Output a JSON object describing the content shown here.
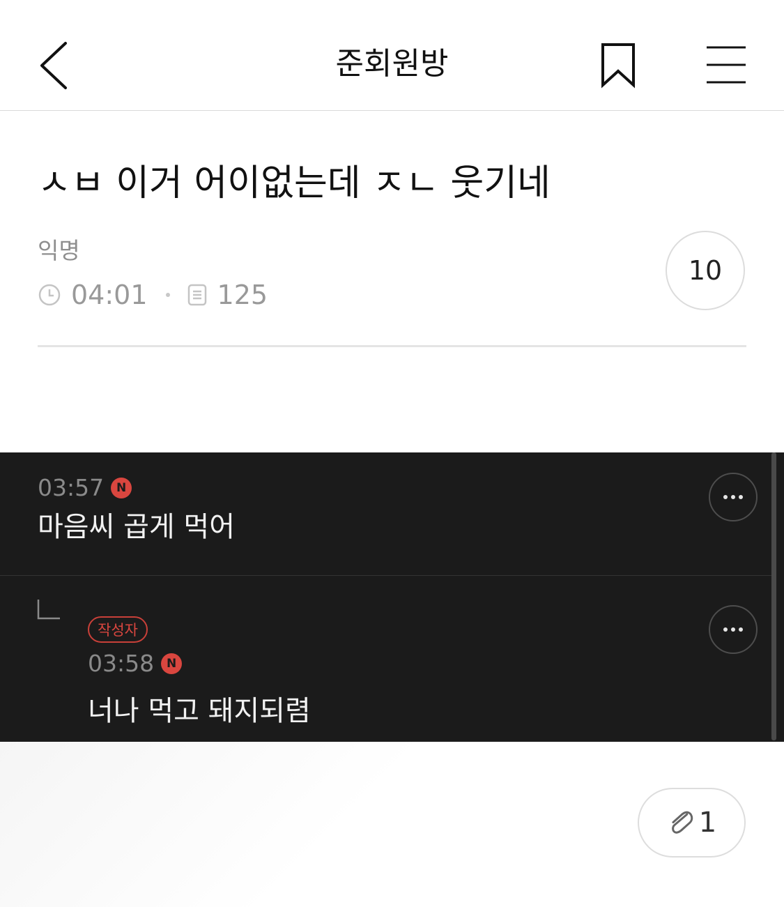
{
  "header": {
    "title": "준회원방",
    "back_icon": "chevron-left-icon",
    "bookmark_icon": "bookmark-icon",
    "menu_icon": "hamburger-menu-icon"
  },
  "post": {
    "title": "ㅅㅂ 이거 어이없는데 ㅈㄴ 웃기네",
    "author": "익명",
    "time": "04:01",
    "views": "125",
    "comment_count": "10"
  },
  "comments": [
    {
      "time": "03:57",
      "new_badge": "N",
      "text": "마음씨 곱게 먹어"
    },
    {
      "is_reply": true,
      "author_badge": "작성자",
      "time": "03:58",
      "new_badge": "N",
      "text": "너나 먹고 돼지되렴"
    }
  ],
  "attachment": {
    "count": "1",
    "icon": "paperclip-icon"
  },
  "colors": {
    "comment_bg": "#1b1b1b",
    "new_badge": "#d9463f",
    "author_badge": "#c94039"
  }
}
